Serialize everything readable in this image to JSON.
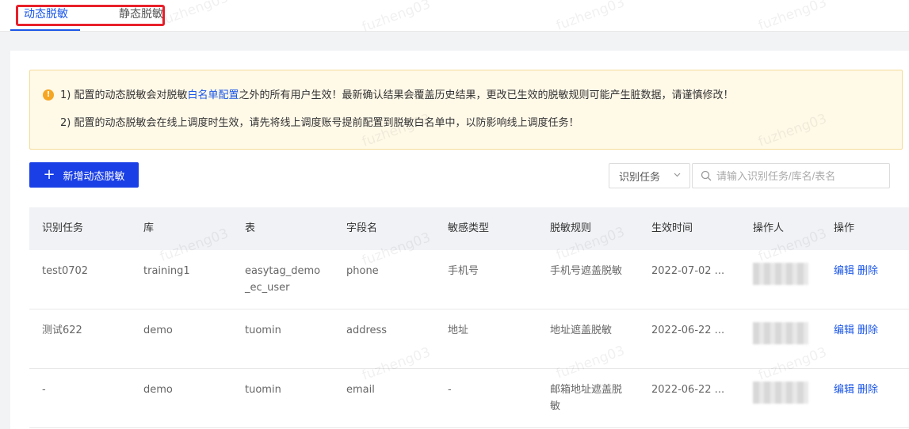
{
  "tabs": [
    {
      "label": "动态脱敏",
      "active": true
    },
    {
      "label": "静态脱敏",
      "active": false
    }
  ],
  "watermark_text": "fuzheng03",
  "alert": {
    "line1_prefix": "1) 配置的动态脱敏会对脱敏",
    "line1_link": "白名单配置",
    "line1_suffix": "之外的所有用户生效！最新确认结果会覆盖历史结果，更改已生效的脱敏规则可能产生脏数据，请谨慎修改！",
    "line2": "2) 配置的动态脱敏会在线上调度时生效，请先将线上调度账号提前配置到脱敏白名单中，以防影响线上调度任务！"
  },
  "toolbar": {
    "add_label": "新增动态脱敏",
    "filter_selected": "识别任务",
    "search_placeholder": "请输入识别任务/库名/表名"
  },
  "table": {
    "headers": [
      "识别任务",
      "库",
      "表",
      "字段名",
      "敏感类型",
      "脱敏规则",
      "生效时间",
      "操作人",
      "操作"
    ],
    "rows": [
      {
        "task": "test0702",
        "db": "training1",
        "table": "easytag_demo_ec_user",
        "field": "phone",
        "type": "手机号",
        "rule": "手机号遮盖脱敏",
        "time": "2022-07-02 ...",
        "edit": "编辑",
        "delete": "删除"
      },
      {
        "task": "测试622",
        "db": "demo",
        "table": "tuomin",
        "field": "address",
        "type": "地址",
        "rule": "地址遮盖脱敏",
        "time": "2022-06-22 ...",
        "edit": "编辑",
        "delete": "删除"
      },
      {
        "task": "-",
        "db": "demo",
        "table": "tuomin",
        "field": "email",
        "type": "-",
        "rule": "邮箱地址遮盖脱敏",
        "time": "2022-06-22 ...",
        "edit": "编辑",
        "delete": "删除"
      }
    ]
  },
  "colors": {
    "accent": "#1a56e8",
    "button": "#1a3fe6",
    "highlight": "#e8202a",
    "alert_bg": "#fff9e8",
    "warn": "#f5a623"
  }
}
